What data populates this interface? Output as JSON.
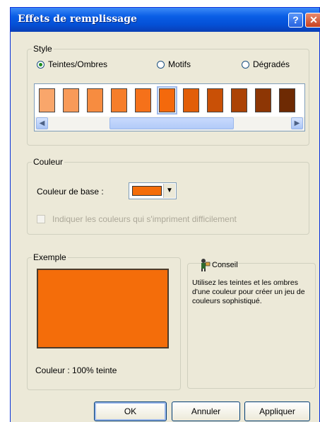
{
  "dialog": {
    "title": "Effets de remplissage",
    "help_glyph": "?",
    "close_glyph": "✕"
  },
  "style_group": {
    "legend": "Style",
    "options": [
      {
        "label": "Teintes/Ombres",
        "selected": true
      },
      {
        "label": "Motifs",
        "selected": false
      },
      {
        "label": "Dégradés",
        "selected": false
      }
    ],
    "swatches": [
      "#f9a66b",
      "#f89a58",
      "#f78c40",
      "#f67e2a",
      "#f5711a",
      "#f4690c",
      "#e25e08",
      "#c95006",
      "#ac4305",
      "#8d3604",
      "#6e2a03"
    ],
    "selected_swatch": 5,
    "scroll_left": "◀",
    "scroll_right": "▶"
  },
  "color_group": {
    "legend": "Couleur",
    "base_label": "Couleur de base :",
    "base_color": "#f46d0a",
    "dropdown_glyph": "▼",
    "checkbox_label": "Indiquer les couleurs qui s'impriment difficilement"
  },
  "example_group": {
    "legend": "Exemple",
    "caption": "Couleur : 100% teinte"
  },
  "tip": {
    "title": "Conseil",
    "text": "Utilisez les teintes et les ombres d'une couleur pour créer un jeu de couleurs sophistiqué."
  },
  "buttons": {
    "ok": "OK",
    "cancel": "Annuler",
    "apply": "Appliquer"
  }
}
